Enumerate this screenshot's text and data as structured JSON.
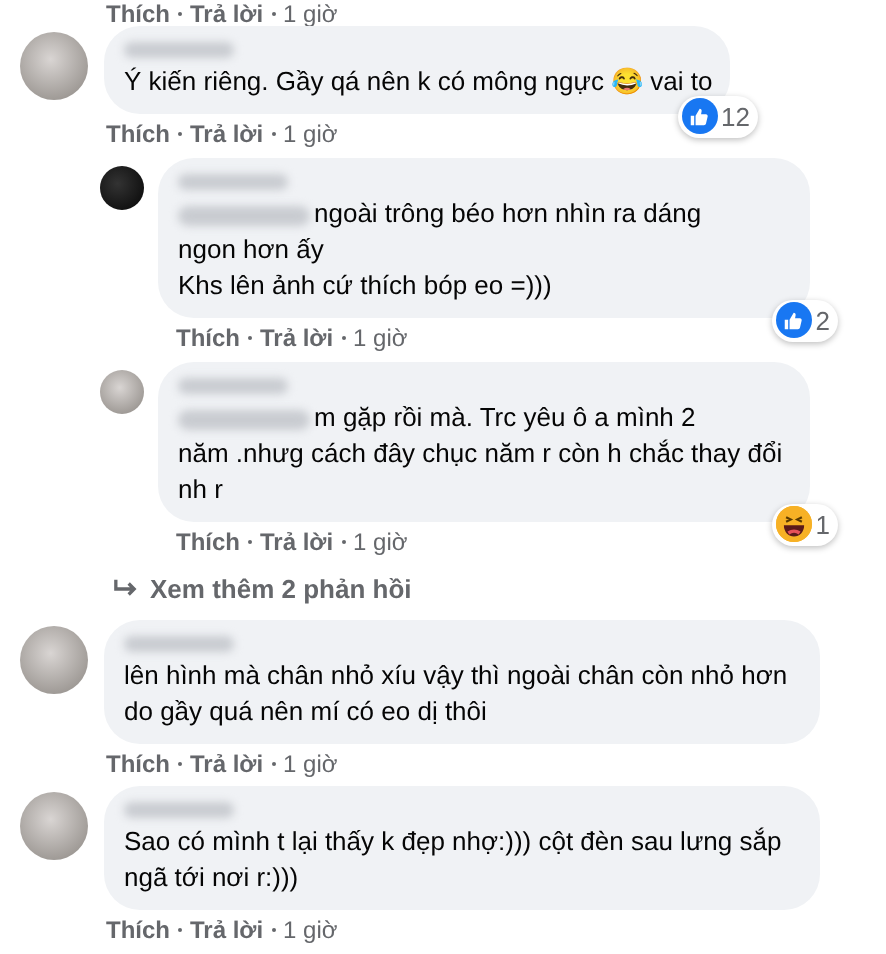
{
  "top_meta": {
    "like": "Thích",
    "reply": "Trả lời",
    "time": "1 giờ"
  },
  "threads": [
    {
      "comment": {
        "lines": [
          "Ý kiến riêng. Gầy qá nên k có mông ngực 😂 vai to"
        ],
        "mention": false,
        "reaction": {
          "kind": "like",
          "count": "12"
        },
        "like": "Thích",
        "reply": "Trả lời",
        "time": "1 giờ"
      },
      "replies": [
        {
          "lines": [
            "ngoài trông béo hơn nhìn ra dáng",
            "ngon hơn ấy",
            "Khs lên ảnh cứ thích bóp eo =)))"
          ],
          "mention": true,
          "reaction": {
            "kind": "like",
            "count": "2"
          },
          "like": "Thích",
          "reply": "Trả lời",
          "time": "1 giờ"
        },
        {
          "lines": [
            "m gặp rồi mà. Trc yêu ô a mình 2",
            "năm .nhưg cách đây chục năm r còn h chắc thay đổi",
            "nh r"
          ],
          "mention": true,
          "reaction": {
            "kind": "haha",
            "count": "1"
          },
          "like": "Thích",
          "reply": "Trả lời",
          "time": "1 giờ"
        }
      ],
      "more_replies": "Xem thêm 2 phản hồi"
    },
    {
      "comment": {
        "lines": [
          "lên hình mà chân nhỏ xíu vậy thì ngoài chân còn nhỏ hơn",
          "do gầy quá nên mí có eo dị thôi"
        ],
        "mention": false,
        "like": "Thích",
        "reply": "Trả lời",
        "time": "1 giờ"
      }
    },
    {
      "comment": {
        "lines": [
          "Sao có mình t lại thấy k đẹp nhợ:))) cột đèn sau lưng sắp",
          "ngã tới nơi r:)))"
        ],
        "mention": false,
        "like": "Thích",
        "reply": "Trả lời",
        "time": "1 giờ"
      }
    }
  ]
}
